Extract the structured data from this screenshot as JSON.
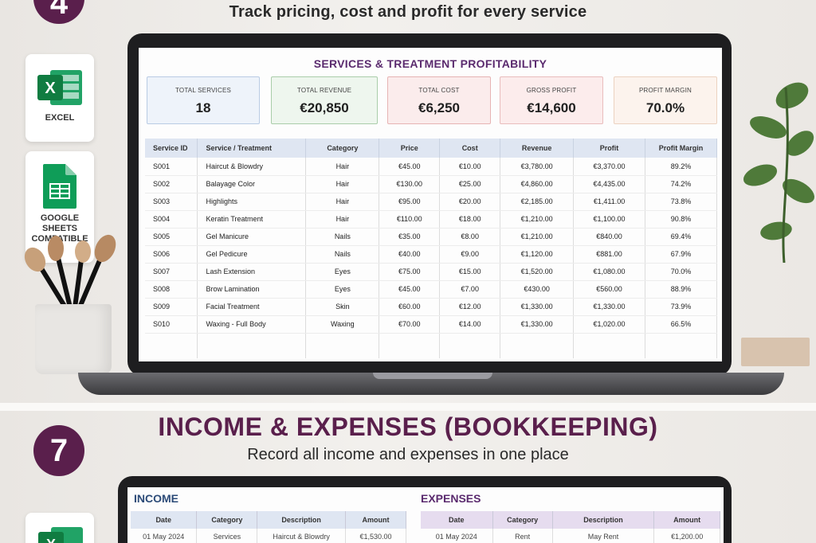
{
  "top": {
    "step_number": "4",
    "subtitle": "Track pricing, cost and profit for every service",
    "badges": {
      "excel_label": "EXCEL",
      "sheets_label": "GOOGLE SHEETS COMPATIBLE"
    },
    "sheet": {
      "title": "SERVICES & TREATMENT PROFITABILITY",
      "kpis": [
        {
          "label": "TOTAL SERVICES",
          "value": "18"
        },
        {
          "label": "TOTAL REVENUE",
          "value": "€20,850"
        },
        {
          "label": "TOTAL COST",
          "value": "€6,250"
        },
        {
          "label": "GROSS PROFIT",
          "value": "€14,600"
        },
        {
          "label": "PROFIT MARGIN",
          "value": "70.0%"
        }
      ],
      "columns": [
        "Service ID",
        "Service / Treatment",
        "Category",
        "Price",
        "Cost",
        "Revenue",
        "Profit",
        "Profit Margin"
      ],
      "rows": [
        [
          "S001",
          "Haircut & Blowdry",
          "Hair",
          "€45.00",
          "€10.00",
          "€3,780.00",
          "€3,370.00",
          "89.2%"
        ],
        [
          "S002",
          "Balayage Color",
          "Hair",
          "€130.00",
          "€25.00",
          "€4,860.00",
          "€4,435.00",
          "74.2%"
        ],
        [
          "S003",
          "Highlights",
          "Hair",
          "€95.00",
          "€20.00",
          "€2,185.00",
          "€1,411.00",
          "73.8%"
        ],
        [
          "S004",
          "Keratin Treatment",
          "Hair",
          "€110.00",
          "€18.00",
          "€1,210.00",
          "€1,100.00",
          "90.8%"
        ],
        [
          "S005",
          "Gel Manicure",
          "Nails",
          "€35.00",
          "€8.00",
          "€1,210.00",
          "€840.00",
          "69.4%"
        ],
        [
          "S006",
          "Gel Pedicure",
          "Nails",
          "€40.00",
          "€9.00",
          "€1,120.00",
          "€881.00",
          "67.9%"
        ],
        [
          "S007",
          "Lash Extension",
          "Eyes",
          "€75.00",
          "€15.00",
          "€1,520.00",
          "€1,080.00",
          "70.0%"
        ],
        [
          "S008",
          "Brow Lamination",
          "Eyes",
          "€45.00",
          "€7.00",
          "€430.00",
          "€560.00",
          "88.9%"
        ],
        [
          "S009",
          "Facial Treatment",
          "Skin",
          "€60.00",
          "€12.00",
          "€1,330.00",
          "€1,330.00",
          "73.9%"
        ],
        [
          "S010",
          "Waxing - Full Body",
          "Waxing",
          "€70.00",
          "€14.00",
          "€1,330.00",
          "€1,020.00",
          "66.5%"
        ]
      ]
    }
  },
  "bottom": {
    "step_number": "7",
    "title": "INCOME & EXPENSES (BOOKKEEPING)",
    "subtitle": "Record all income and expenses in one place",
    "income": {
      "title": "INCOME",
      "columns": [
        "Date",
        "Category",
        "Description",
        "Amount"
      ],
      "rows": [
        [
          "01 May 2024",
          "Services",
          "Haircut & Blowdry",
          "€1,530.00"
        ]
      ]
    },
    "expenses": {
      "title": "EXPENSES",
      "columns": [
        "Date",
        "Category",
        "Description",
        "Amount"
      ],
      "rows": [
        [
          "01 May 2024",
          "Rent",
          "May Rent",
          "€1,200.00"
        ]
      ]
    }
  },
  "colors": {
    "accent_plum": "#5a1f4c",
    "sheet_title": "#5a2a6e",
    "income_title": "#2c4b78"
  }
}
